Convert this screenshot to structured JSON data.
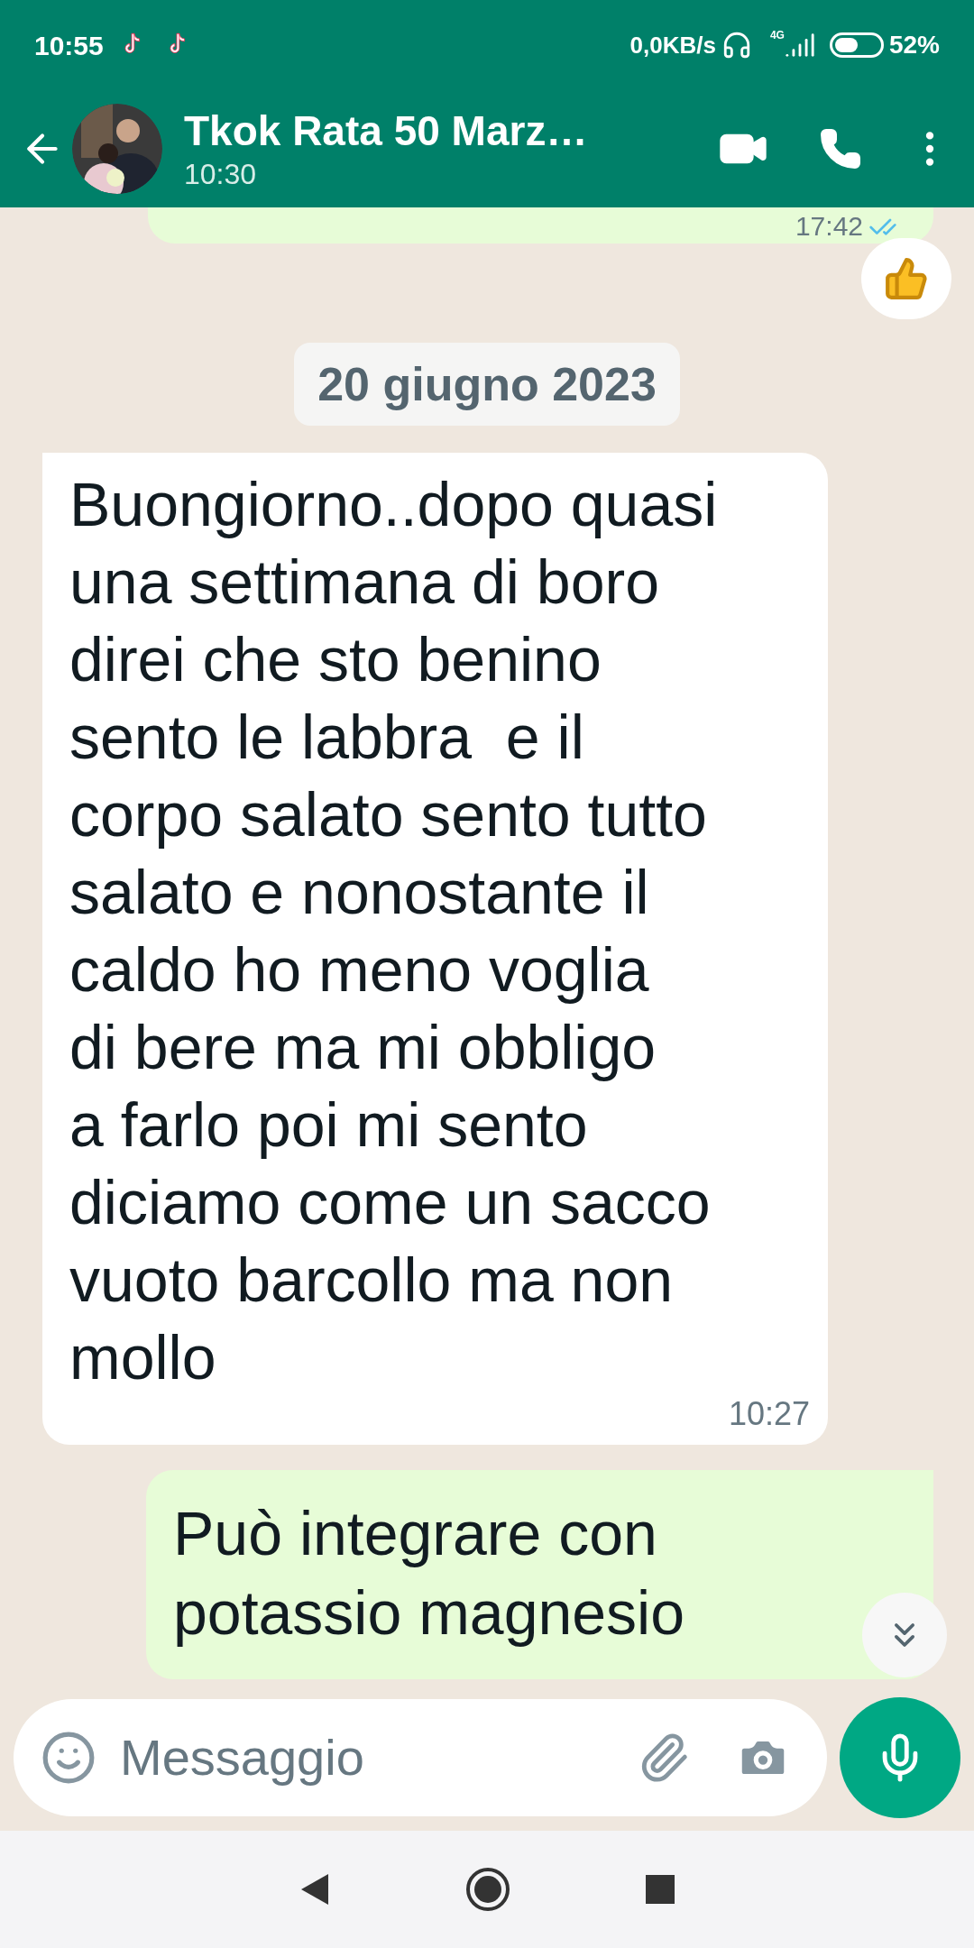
{
  "status_bar": {
    "time": "10:55",
    "data_rate": "0,0KB/s",
    "network": "4G",
    "battery": "52%"
  },
  "header": {
    "name": "Tkok Rata 50 Marz…",
    "subtitle": "10:30"
  },
  "messages": [
    {
      "kind": "sent",
      "time": "17:42",
      "read": true,
      "reaction": true
    },
    {
      "kind": "date",
      "text": "20 giugno 2023"
    },
    {
      "kind": "received",
      "text": "Buongiorno..dopo quasi\nuna settimana di boro\ndirei che sto benino\nsento le labbra  e il\ncorpo salato sento tutto\nsalato e nonostante il\ncaldo ho meno voglia\ndi bere ma mi obbligo\na farlo poi mi sento\ndiciamo come un sacco\nvuoto barcollo ma non\nmollo",
      "time": "10:27"
    },
    {
      "kind": "sent",
      "text": "Può integrare con\npotassio magnesio"
    }
  ],
  "composer": {
    "placeholder": "Messaggio"
  }
}
